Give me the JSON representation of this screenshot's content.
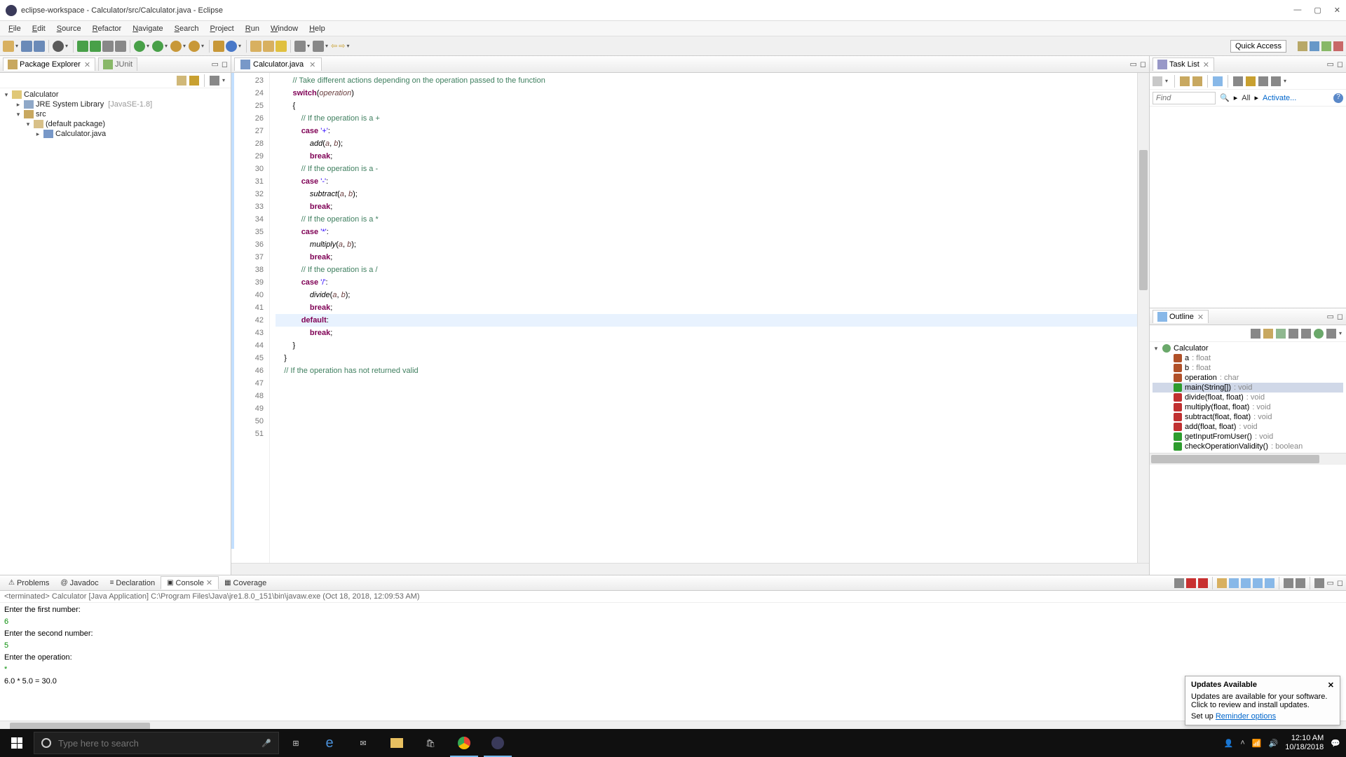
{
  "window": {
    "title": "eclipse-workspace - Calculator/src/Calculator.java - Eclipse"
  },
  "menu": [
    "File",
    "Edit",
    "Source",
    "Refactor",
    "Navigate",
    "Search",
    "Project",
    "Run",
    "Window",
    "Help"
  ],
  "quick_access": "Quick Access",
  "package_explorer": {
    "title": "Package Explorer",
    "junit_tab": "JUnit",
    "project": "Calculator",
    "jre": "JRE System Library",
    "jre_hint": "[JavaSE-1.8]",
    "src": "src",
    "pkg": "(default package)",
    "file": "Calculator.java"
  },
  "editor": {
    "tab": "Calculator.java",
    "first_line": 23,
    "lines": [
      {
        "n": 23,
        "seg": [
          [
            "        ",
            "p"
          ],
          [
            "// Take different actions depending on the operation passed to the function",
            "cmt"
          ]
        ]
      },
      {
        "n": 24,
        "seg": [
          [
            "        ",
            "p"
          ],
          [
            "switch",
            "kw"
          ],
          [
            "(",
            "p"
          ],
          [
            "operation",
            "var"
          ],
          [
            ")",
            "p"
          ]
        ]
      },
      {
        "n": 25,
        "seg": [
          [
            "        {",
            "p"
          ]
        ]
      },
      {
        "n": 26,
        "seg": [
          [
            "            ",
            "p"
          ],
          [
            "// If the operation is a +",
            "cmt"
          ]
        ]
      },
      {
        "n": 27,
        "seg": [
          [
            "            ",
            "p"
          ],
          [
            "case",
            "kw"
          ],
          [
            " ",
            "p"
          ],
          [
            "'+'",
            "str"
          ],
          [
            ":",
            "p"
          ]
        ]
      },
      {
        "n": 28,
        "seg": [
          [
            "                ",
            "p"
          ],
          [
            "add",
            "fn"
          ],
          [
            "(",
            "p"
          ],
          [
            "a",
            "var"
          ],
          [
            ", ",
            "p"
          ],
          [
            "b",
            "var"
          ],
          [
            ");",
            "p"
          ]
        ]
      },
      {
        "n": 29,
        "seg": [
          [
            "                ",
            "p"
          ],
          [
            "break",
            "kw"
          ],
          [
            ";",
            "p"
          ]
        ]
      },
      {
        "n": 30,
        "seg": [
          [
            "",
            "p"
          ]
        ]
      },
      {
        "n": 31,
        "seg": [
          [
            "            ",
            "p"
          ],
          [
            "// If the operation is a -",
            "cmt"
          ]
        ]
      },
      {
        "n": 32,
        "seg": [
          [
            "            ",
            "p"
          ],
          [
            "case",
            "kw"
          ],
          [
            " ",
            "p"
          ],
          [
            "'-'",
            "str"
          ],
          [
            ":",
            "p"
          ]
        ]
      },
      {
        "n": 33,
        "seg": [
          [
            "                ",
            "p"
          ],
          [
            "subtract",
            "fn"
          ],
          [
            "(",
            "p"
          ],
          [
            "a",
            "var"
          ],
          [
            ", ",
            "p"
          ],
          [
            "b",
            "var"
          ],
          [
            ");",
            "p"
          ]
        ]
      },
      {
        "n": 34,
        "seg": [
          [
            "                ",
            "p"
          ],
          [
            "break",
            "kw"
          ],
          [
            ";",
            "p"
          ]
        ]
      },
      {
        "n": 35,
        "seg": [
          [
            "",
            "p"
          ]
        ]
      },
      {
        "n": 36,
        "seg": [
          [
            "            ",
            "p"
          ],
          [
            "// If the operation is a *",
            "cmt"
          ]
        ]
      },
      {
        "n": 37,
        "seg": [
          [
            "            ",
            "p"
          ],
          [
            "case",
            "kw"
          ],
          [
            " ",
            "p"
          ],
          [
            "'*'",
            "str"
          ],
          [
            ":",
            "p"
          ]
        ]
      },
      {
        "n": 38,
        "seg": [
          [
            "                ",
            "p"
          ],
          [
            "multiply",
            "fn"
          ],
          [
            "(",
            "p"
          ],
          [
            "a",
            "var"
          ],
          [
            ", ",
            "p"
          ],
          [
            "b",
            "var"
          ],
          [
            ");",
            "p"
          ]
        ]
      },
      {
        "n": 39,
        "seg": [
          [
            "                ",
            "p"
          ],
          [
            "break",
            "kw"
          ],
          [
            ";",
            "p"
          ]
        ]
      },
      {
        "n": 40,
        "seg": [
          [
            "",
            "p"
          ]
        ]
      },
      {
        "n": 41,
        "seg": [
          [
            "            ",
            "p"
          ],
          [
            "// If the operation is a /",
            "cmt"
          ]
        ]
      },
      {
        "n": 42,
        "seg": [
          [
            "            ",
            "p"
          ],
          [
            "case",
            "kw"
          ],
          [
            " ",
            "p"
          ],
          [
            "'/'",
            "str"
          ],
          [
            ":",
            "p"
          ]
        ]
      },
      {
        "n": 43,
        "seg": [
          [
            "                ",
            "p"
          ],
          [
            "divide",
            "fn"
          ],
          [
            "(",
            "p"
          ],
          [
            "a",
            "var"
          ],
          [
            ", ",
            "p"
          ],
          [
            "b",
            "var"
          ],
          [
            ");",
            "p"
          ]
        ]
      },
      {
        "n": 44,
        "seg": [
          [
            "                ",
            "p"
          ],
          [
            "break",
            "kw"
          ],
          [
            ";",
            "p"
          ]
        ]
      },
      {
        "n": 45,
        "seg": [
          [
            "",
            "p"
          ]
        ]
      },
      {
        "n": 46,
        "current": true,
        "seg": [
          [
            "            ",
            "p"
          ],
          [
            "default",
            "kw"
          ],
          [
            ":",
            "p"
          ]
        ]
      },
      {
        "n": 47,
        "seg": [
          [
            "                ",
            "p"
          ],
          [
            "break",
            "kw"
          ],
          [
            ";",
            "p"
          ]
        ]
      },
      {
        "n": 48,
        "seg": [
          [
            "        }",
            "p"
          ]
        ]
      },
      {
        "n": 49,
        "seg": [
          [
            "    }",
            "p"
          ]
        ]
      },
      {
        "n": 50,
        "seg": [
          [
            "",
            "p"
          ]
        ]
      },
      {
        "n": 51,
        "seg": [
          [
            "    ",
            "p"
          ],
          [
            "// If the operation has not returned valid",
            "cmt"
          ]
        ]
      }
    ]
  },
  "tasklist": {
    "title": "Task List",
    "find": "Find",
    "all": "All",
    "activate": "Activate..."
  },
  "outline": {
    "title": "Outline",
    "class": "Calculator",
    "members": [
      {
        "icon": "#b05028",
        "name": "a",
        "type": ": float"
      },
      {
        "icon": "#b05028",
        "name": "b",
        "type": ": float"
      },
      {
        "icon": "#b05028",
        "name": "operation",
        "type": ": char"
      },
      {
        "icon": "#2e9c2e",
        "name": "main(String[])",
        "type": ": void",
        "selected": true
      },
      {
        "icon": "#c03030",
        "name": "divide(float, float)",
        "type": ": void"
      },
      {
        "icon": "#c03030",
        "name": "multiply(float, float)",
        "type": ": void"
      },
      {
        "icon": "#c03030",
        "name": "subtract(float, float)",
        "type": ": void"
      },
      {
        "icon": "#c03030",
        "name": "add(float, float)",
        "type": ": void"
      },
      {
        "icon": "#2e9c2e",
        "name": "getInputFromUser()",
        "type": ": void"
      },
      {
        "icon": "#2e9c2e",
        "name": "checkOperationValidity()",
        "type": ": boolean"
      }
    ]
  },
  "bottom": {
    "tabs": [
      "Problems",
      "Javadoc",
      "Declaration",
      "Console",
      "Coverage"
    ],
    "active": 3,
    "console_meta": "<terminated> Calculator [Java Application] C:\\Program Files\\Java\\jre1.8.0_151\\bin\\javaw.exe (Oct 18, 2018, 12:09:53 AM)",
    "lines": [
      {
        "t": "Enter the first number:",
        "c": "out"
      },
      {
        "t": "6",
        "c": "in"
      },
      {
        "t": "Enter the second number:",
        "c": "out"
      },
      {
        "t": "5",
        "c": "in"
      },
      {
        "t": "Enter the operation:",
        "c": "out"
      },
      {
        "t": "*",
        "c": "in"
      },
      {
        "t": "6.0 * 5.0 = 30.0",
        "c": "out"
      }
    ]
  },
  "updates": {
    "title": "Updates Available",
    "body": "Updates are available for your software. Click to review and install updates.",
    "setup": "Set up ",
    "link": "Reminder options"
  },
  "taskbar": {
    "search_placeholder": "Type here to search",
    "time": "12:10 AM",
    "date": "10/18/2018"
  }
}
